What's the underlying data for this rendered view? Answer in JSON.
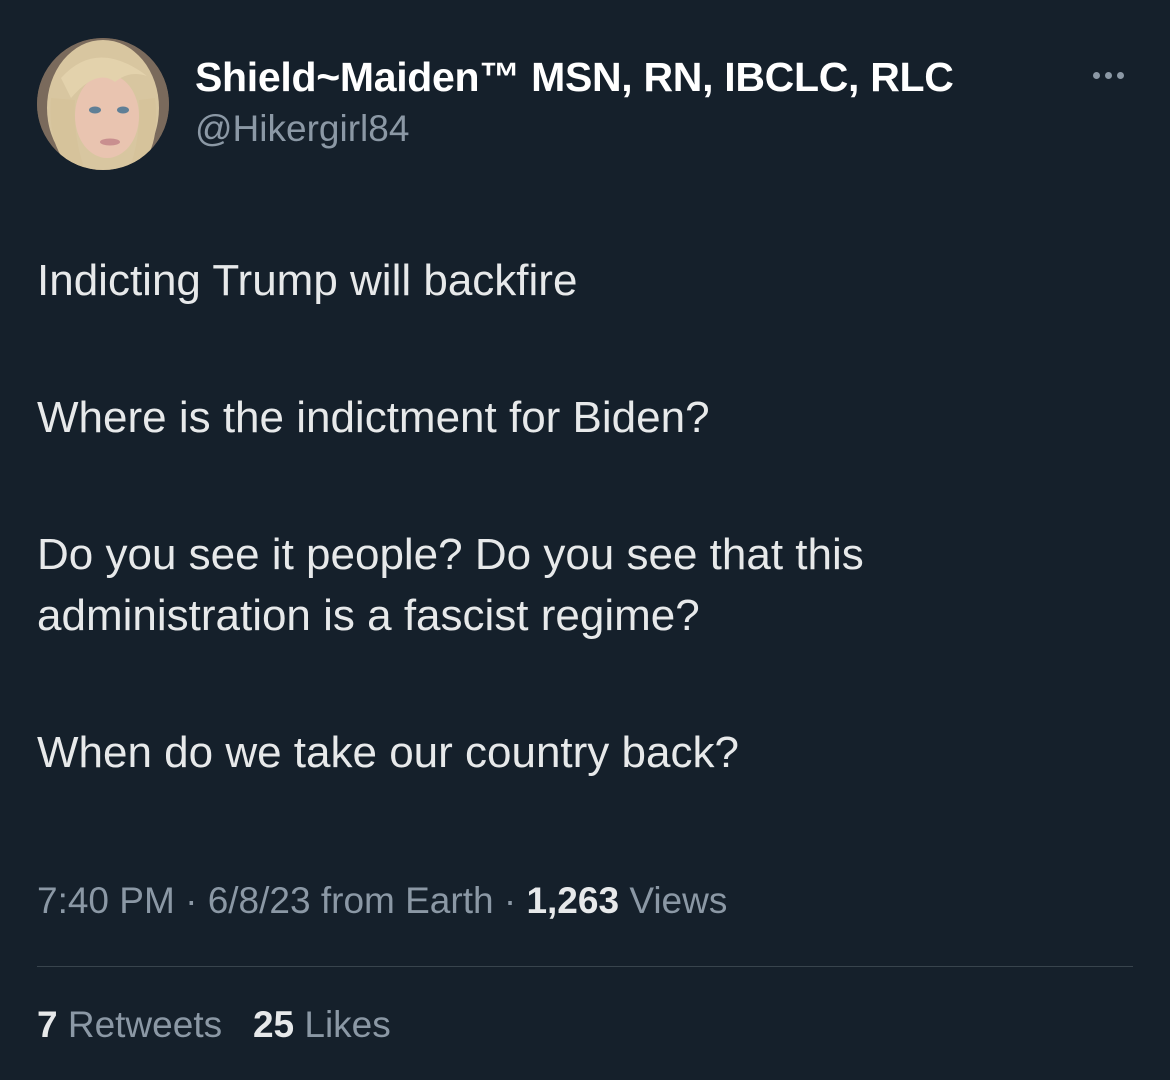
{
  "tweet": {
    "display_name": "Shield~Maiden™ MSN, RN, IBCLC, RLC",
    "handle": "@Hikergirl84",
    "more_icon": "ellipsis-icon",
    "body": [
      "Indicting Trump will backfire",
      "Where is the indictment for Biden?",
      "Do you see it people? Do you see that this administration is a fascist regime?",
      "When do we take our country back?"
    ],
    "time": "7:40 PM",
    "date": "6/8/23",
    "source": "from Earth",
    "separator": " · ",
    "views_count": "1,263",
    "views_label": "Views",
    "retweets_count": "7",
    "retweets_label": "Retweets",
    "likes_count": "25",
    "likes_label": "Likes"
  },
  "colors": {
    "background": "#15202b",
    "primary_text": "#e7e9ea",
    "secondary_text": "#8b98a5",
    "divider": "#38444d"
  }
}
